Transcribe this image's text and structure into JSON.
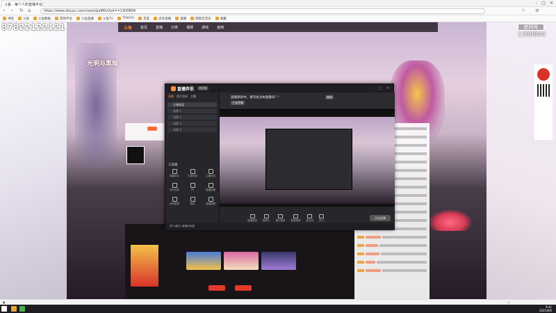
{
  "browser": {
    "tab_title": "斗鱼 - 每个人的直播平台",
    "url": "https://www.douyu.com/room/pxM0vVyd==1300804",
    "bookmarks": [
      "书签",
      "斗鱼",
      "斗鱼数据",
      "游戏平台",
      "斗鱼直播",
      "斗鱼TV",
      "TFBOYS",
      "百度",
      "虎牙直播",
      "直播",
      "网易云音乐",
      "收藏"
    ]
  },
  "page": {
    "phone_number": "87822122121",
    "room_badge": "房间号",
    "room_id": "1300804",
    "site_logo": "斗鱼",
    "nav_items": [
      "首页",
      "直播",
      "分类",
      "视频",
      "游戏",
      "鱼吧"
    ],
    "game_title": "光明与黑暗"
  },
  "app": {
    "name": "直播伴侣",
    "version": "测试版",
    "side_tabs": [
      "直播",
      "用户资料",
      "主播"
    ],
    "scenes": [
      "主播画面",
      "场景 1",
      "场景 2",
      "场景 3",
      "场景 4"
    ],
    "tools_label": "工具箱",
    "tools": [
      "弹幕助手",
      "礼物答谢",
      "主播任务",
      "观众连麦",
      "PK",
      "直播设置",
      "房间管理",
      "抽奖",
      "直播数据"
    ],
    "stream_title": "直播测试中，请勿关注本直播间！！",
    "stream_tag": "编辑",
    "category": "王者荣耀",
    "bottom_tools": [
      "直播美颜",
      "摄像头",
      "窗口捕获",
      "屏幕捕获",
      "麦克风",
      "声卡"
    ],
    "start_button": "开始直播",
    "footer_text": "按F1键进入直播间设置"
  },
  "taskbar": {
    "time": "9:41",
    "date": "2021/8/6"
  },
  "colors": {
    "accent": "#ff8b3a",
    "douyu_orange": "#ff7b2c"
  }
}
